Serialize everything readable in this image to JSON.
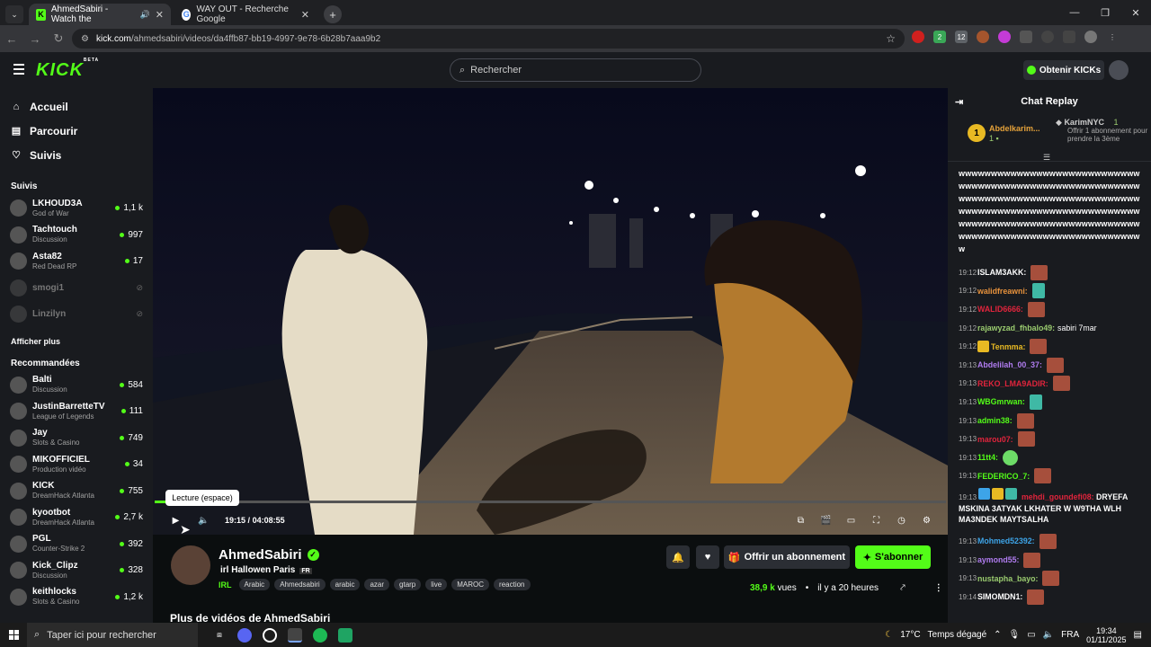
{
  "browser": {
    "tabs": [
      {
        "title": "AhmedSabiri - Watch the",
        "active": true
      },
      {
        "title": "WAY OUT - Recherche Google",
        "active": false
      }
    ],
    "url_host": "kick.com",
    "url_path": "/ahmedsabiri/videos/da4ffb87-bb19-4997-9e78-6b28b7aaa9b2",
    "ext_badges": [
      "2",
      "12"
    ]
  },
  "header": {
    "logo": "KICK",
    "logo_sup": "BETA",
    "search_placeholder": "Rechercher",
    "get_kicks": "Obtenir KICKs"
  },
  "sidebar": {
    "nav": [
      {
        "label": "Accueil",
        "icon": "home-icon"
      },
      {
        "label": "Parcourir",
        "icon": "browse-icon"
      },
      {
        "label": "Suivis",
        "icon": "heart-icon"
      }
    ],
    "followed_title": "Suivis",
    "followed": [
      {
        "name": "LKHOUD3A",
        "category": "God of War",
        "viewers": "1,1 k",
        "online": true
      },
      {
        "name": "Tachtouch",
        "category": "Discussion",
        "viewers": "997",
        "online": true
      },
      {
        "name": "Asta82",
        "category": "Red Dead RP",
        "viewers": "17",
        "online": true
      },
      {
        "name": "smogi1",
        "category": "",
        "viewers": "",
        "online": false
      },
      {
        "name": "Linzilyn",
        "category": "",
        "viewers": "",
        "online": false
      }
    ],
    "show_more": "Afficher plus",
    "recommended_title": "Recommandées",
    "recommended": [
      {
        "name": "Balti",
        "category": "Discussion",
        "viewers": "584"
      },
      {
        "name": "JustinBarretteTV",
        "category": "League of Legends",
        "viewers": "111"
      },
      {
        "name": "Jay",
        "category": "Slots & Casino",
        "viewers": "749"
      },
      {
        "name": "MIKOFFICIEL",
        "category": "Production vidéo",
        "viewers": "34"
      },
      {
        "name": "KICK",
        "category": "DreamHack Atlanta",
        "viewers": "755"
      },
      {
        "name": "kyootbot",
        "category": "DreamHack Atlanta",
        "viewers": "2,7 k"
      },
      {
        "name": "PGL",
        "category": "Counter-Strike 2",
        "viewers": "392"
      },
      {
        "name": "Kick_Clipz",
        "category": "Discussion",
        "viewers": "328"
      },
      {
        "name": "keithlocks",
        "category": "Slots & Casino",
        "viewers": "1,2 k"
      }
    ]
  },
  "player": {
    "tooltip": "Lecture (espace)",
    "current_time": "19:15",
    "separator": "/",
    "duration": "04:08:55",
    "progress": 0.0775
  },
  "channel": {
    "name": "AhmedSabiri",
    "title": "irl Hallowen Paris",
    "lang": "FR",
    "category": "IRL",
    "tags": [
      "Arabic",
      "Ahmedsabiri",
      "arabic",
      "azar",
      "gtarp",
      "live",
      "MAROC",
      "reaction"
    ],
    "subscribe_label": "Offrir un abonnement",
    "follow_label": "S'abonner",
    "views": "38,9 k",
    "views_unit": "vues",
    "ago": "il y a 20 heures",
    "more_videos": "Plus de vidéos de AhmedSabiri"
  },
  "chat": {
    "title": "Chat Replay",
    "pinned_rank": "1",
    "pinned_user": "Abdelkarim...",
    "pinned_user_count": "1",
    "gift_user": "KarimNYC",
    "gift_count": "1",
    "gift_text": "Offrir 1 abonnement pour prendre la 3ème",
    "spam": "wwwwwwwwwwwwwwwwwwwwwwwwwwwwwwwwwwwwwwwwwwwwwwwwwwwwwwwwwwwwwwwwwwwwwwwwwwwwwwwwwwwwwwwwwwwwwwwwwwwwwwwwwwwwwwwwwwwwwwwwwwwwwwwwwwwwwwwwwwwwwwwwwwwwwwwwwwwwwwwwwwwwwwwww",
    "messages": [
      {
        "time": "19:12",
        "user": "ISLAM3AKK:",
        "color": "#ffffff",
        "text": "",
        "emote": "e"
      },
      {
        "time": "19:12",
        "user": "walidfreawni:",
        "color": "#e8923c",
        "text": "",
        "emote": "c"
      },
      {
        "time": "19:12",
        "user": "WALID6666:",
        "color": "#e0243c",
        "text": "",
        "emote": "e"
      },
      {
        "time": "19:12",
        "user": "rajawyzad_fhbalo49:",
        "color": "#9acb6f",
        "text": "sabiri 7mar",
        "emote": ""
      },
      {
        "time": "19:12",
        "user": "Tenmma:",
        "color": "#e8b923",
        "text": "",
        "emote": "e"
      },
      {
        "time": "19:13",
        "user": "Abdelilah_00_37:",
        "color": "#b07cf0",
        "text": "",
        "emote": "e"
      },
      {
        "time": "19:13",
        "user": "REKO_LMA9ADIR:",
        "color": "#e0243c",
        "text": "",
        "emote": "e"
      },
      {
        "time": "19:13",
        "user": "WBGmrwan:",
        "color": "#53fc18",
        "text": "",
        "emote": "c"
      },
      {
        "time": "19:13",
        "user": "admin38:",
        "color": "#53fc18",
        "text": "",
        "emote": "e"
      },
      {
        "time": "19:13",
        "user": "marou07:",
        "color": "#e0243c",
        "text": "",
        "emote": "e"
      },
      {
        "time": "19:13",
        "user": "11tt4:",
        "color": "#53fc18",
        "text": "",
        "emote": "g"
      },
      {
        "time": "19:13",
        "user": "FEDERICO_7:",
        "color": "#53fc18",
        "text": "",
        "emote": "e"
      }
    ],
    "long_msg": {
      "time": "19:13",
      "user": "mehdi_goundefi08:",
      "text": "DRYEFA MSKINA 3ATYAK LKHATER W W9THA WLH MA3NDEK MAYTSALHA"
    },
    "messages2": [
      {
        "time": "19:13",
        "user": "Mohmed52392:",
        "color": "#3da4e8",
        "text": "",
        "emote": "e"
      },
      {
        "time": "19:13",
        "user": "aymond55:",
        "color": "#b07cf0",
        "text": "",
        "emote": "e"
      },
      {
        "time": "19:13",
        "user": "nustapha_bayo:",
        "color": "#9acb6f",
        "text": "",
        "emote": "e"
      },
      {
        "time": "19:14",
        "user": "SIMOMDN1:",
        "color": "#ffffff",
        "text": "",
        "emote": "e"
      }
    ]
  },
  "taskbar": {
    "search": "Taper ici pour rechercher",
    "weather": "17°C",
    "weather_desc": "Temps dégagé",
    "lang": "FRA",
    "time": "19:34",
    "date": "01/11/2025"
  }
}
